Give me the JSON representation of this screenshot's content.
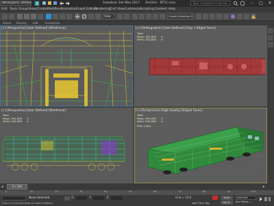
{
  "titlebar": {
    "workspace": "Workspace: Default",
    "app_title": "Autodesk 3ds Max 2017",
    "file_title": "2te10m - 8T51.max",
    "search_placeholder": "Type a keyword or phrase",
    "minimize": "–",
    "maximize": "□",
    "close": "✕"
  },
  "menu": {
    "items": [
      "Edit",
      "Tools",
      "Group",
      "Views",
      "Create",
      "Modifiers",
      "Animation",
      "Graph Editors",
      "Rendering",
      "Civil View",
      "Customize",
      "Scripting",
      "Content",
      "Help"
    ]
  },
  "toolbar": {
    "selection_set": "Create Selection Set",
    "view_dropdown": "View"
  },
  "subbar": {
    "items": [
      "Select",
      "Display",
      "Edit",
      "Customize"
    ]
  },
  "viewports": {
    "top_left": {
      "label": "[+] [Perspective] [User Defined] [Wireframe]"
    },
    "top_right": {
      "label": "[+] [Orthographic] [User Defined] [Clay + Edged Faces]",
      "stats": {
        "total": "Total",
        "polys_label": "Polys:",
        "polys": "391,630",
        "polys_sel": "0",
        "verts_label": "Verts:",
        "verts": "202,836",
        "verts_sel": "0"
      }
    },
    "bottom_left": {
      "label": "[+] [Perspective] [User Defined] [Wireframe]",
      "stats": {
        "total": "Total",
        "polys_label": "Polys:",
        "polys": "391,630",
        "polys_sel": "0",
        "verts_label": "Verts:",
        "verts": "202,836",
        "verts_sel": "0"
      }
    },
    "bottom_right": {
      "label": "[+] [Perspective] [High Quality] [Edged Faces]",
      "stats": {
        "total": "Total",
        "polys_label": "Polys:",
        "polys": "391,630",
        "polys_sel": "0",
        "verts_label": "Verts:",
        "verts": "202,836",
        "verts_sel": "0",
        "fps_label": "FPS:",
        "fps": "2.441"
      }
    }
  },
  "timeline": {
    "frame": "0 / 100",
    "ticks": [
      "0",
      "10",
      "20",
      "30",
      "40",
      "50",
      "60",
      "70",
      "80",
      "90",
      "100"
    ]
  },
  "status": {
    "selection": "None Selected",
    "prompt": "Click or click-and-drag to select objects",
    "x_label": "X:",
    "y_label": "Y:",
    "z_label": "Z:",
    "grid": "Grid = 10,0",
    "add_time_tag": "Add Time Tag",
    "auto_key": "Auto",
    "set_key": "Set K.",
    "selected": "Selected",
    "key_filters": "Key Filters..."
  },
  "colors": {
    "accent": "#2d8fd4",
    "wire_yellow": "#e6d23c",
    "wire_green": "#2ec24a",
    "wire_cyan": "#3cc8d8",
    "loco_green": "#2f8a3c",
    "loco_red": "#a33a3a"
  }
}
